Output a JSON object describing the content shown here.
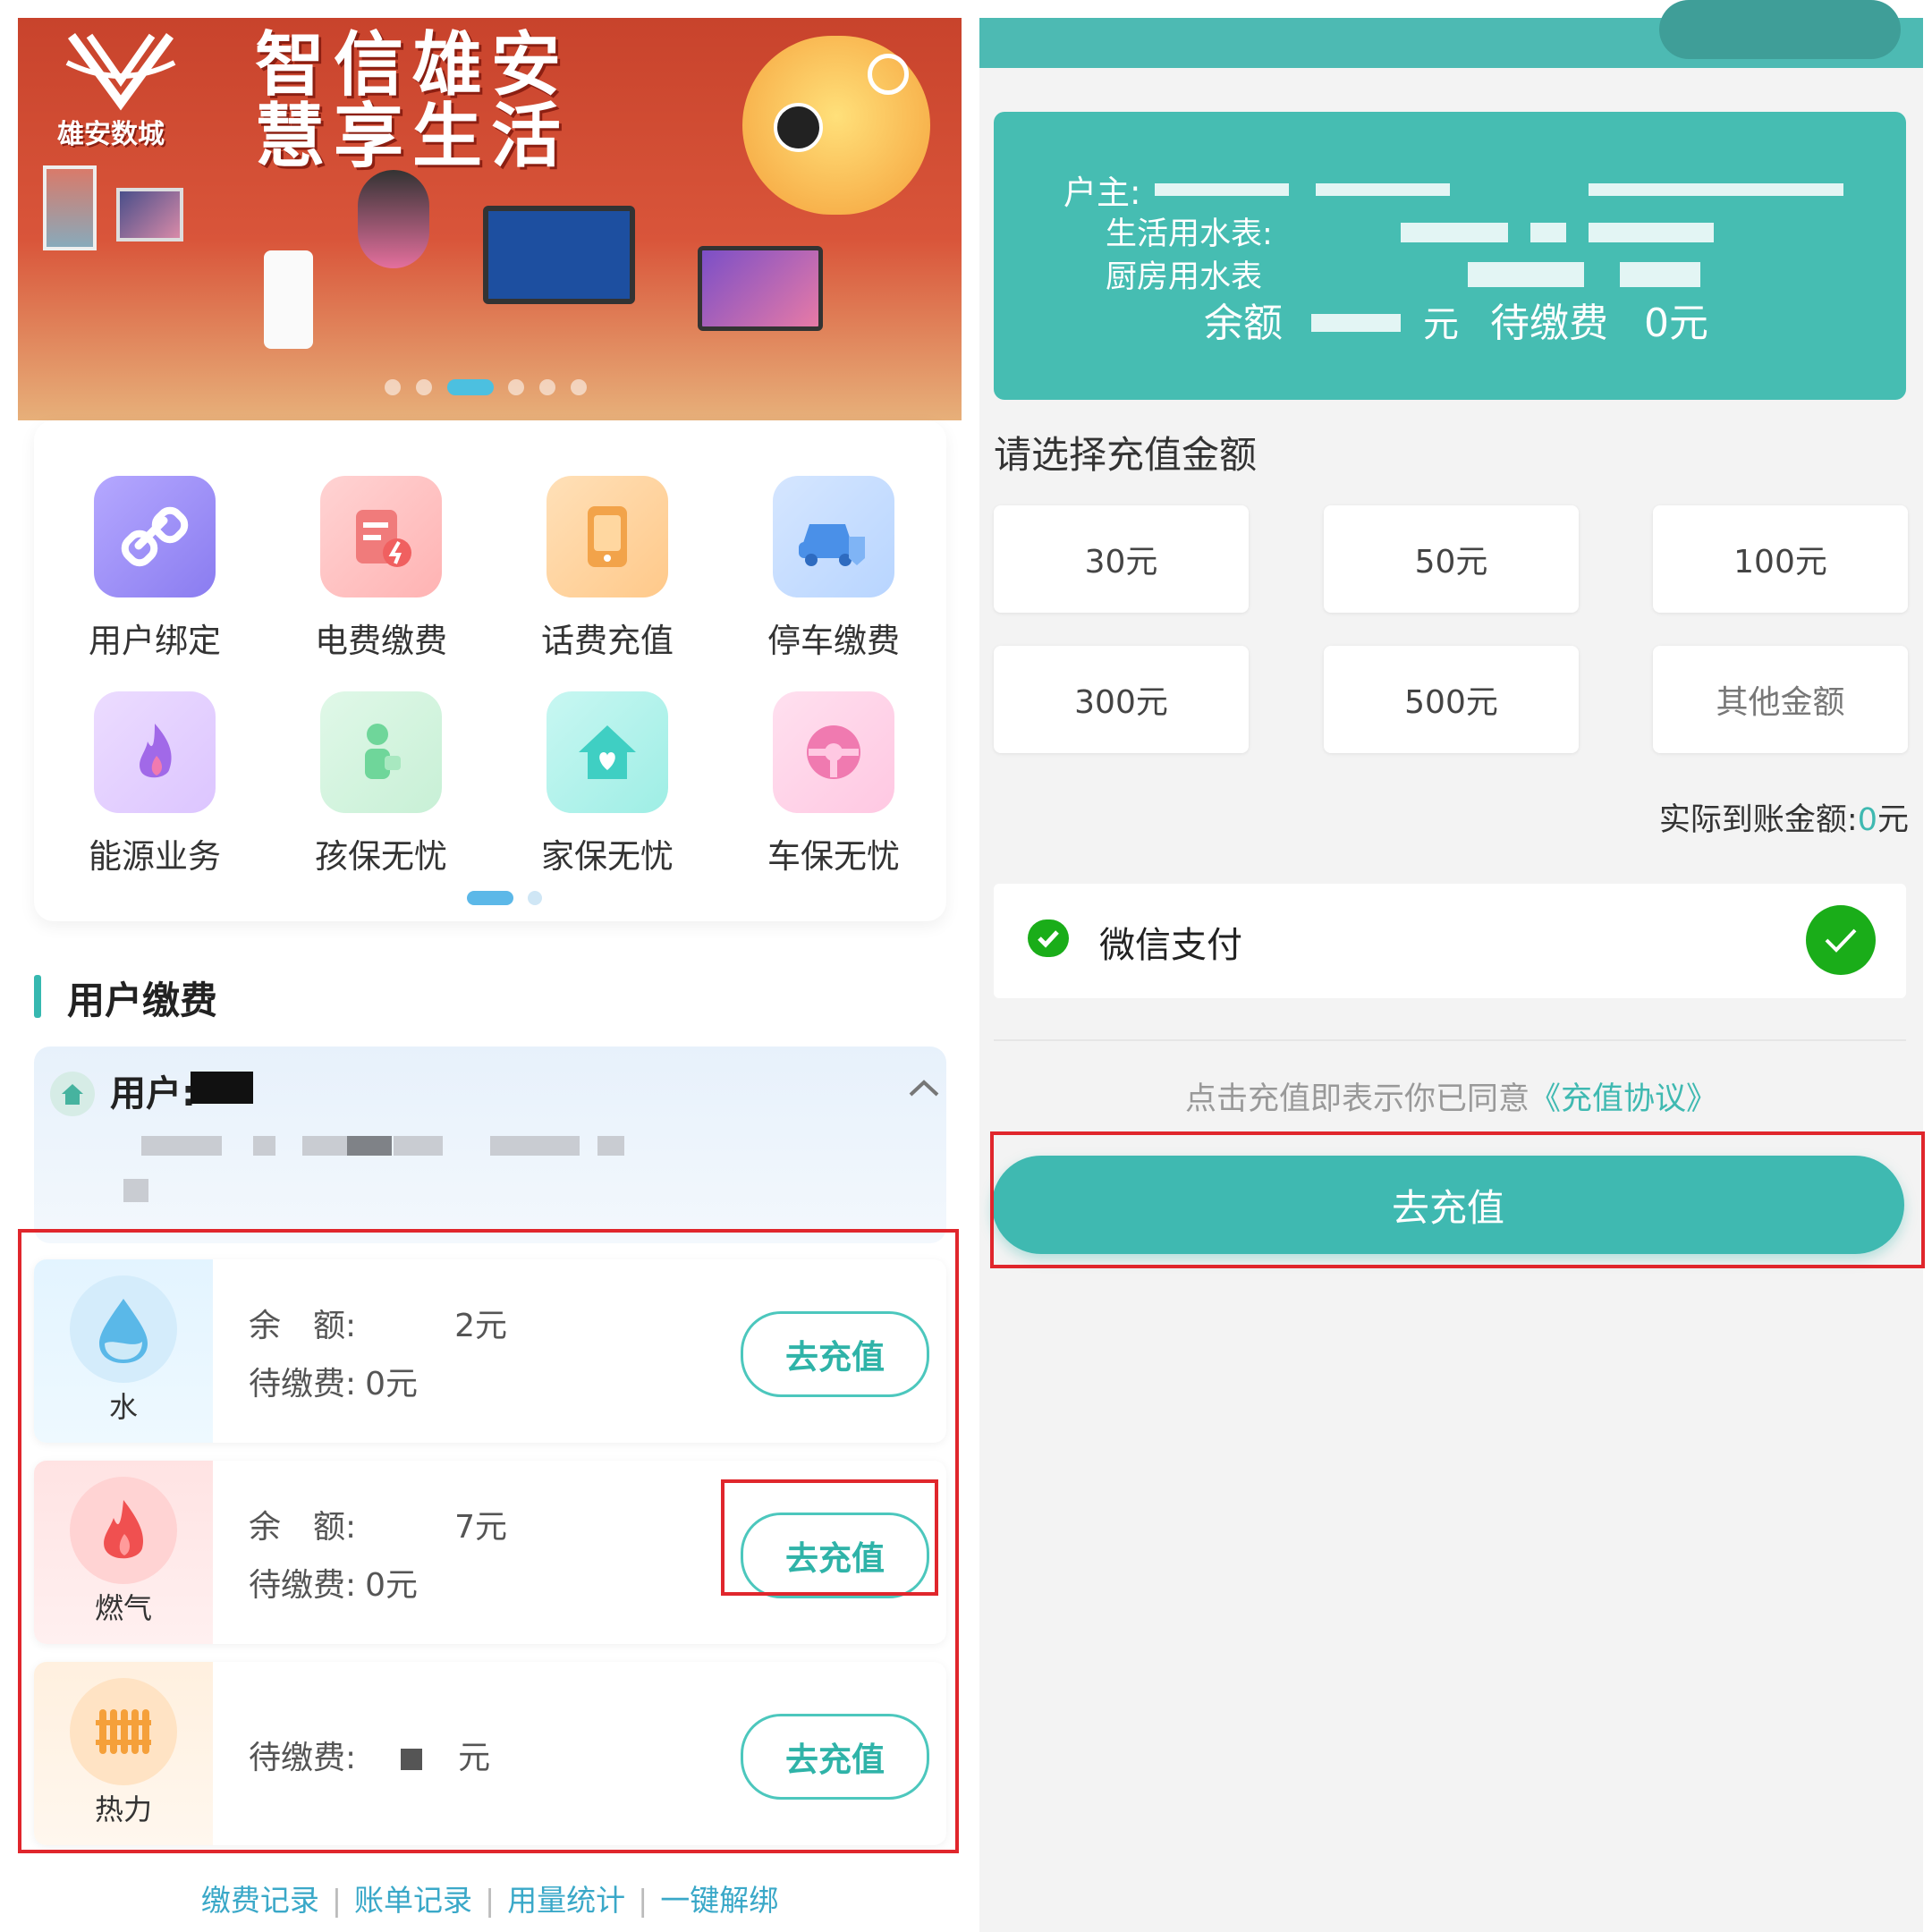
{
  "left": {
    "banner": {
      "slogan_line1": "智信雄安",
      "slogan_line2": "慧享生活",
      "brand_name": "雄安数城",
      "carousel_dots": 6,
      "carousel_active_index": 2
    },
    "services": [
      {
        "label": "用户绑定",
        "icon": "link-icon",
        "color": "#8a7cf0"
      },
      {
        "label": "电费缴费",
        "icon": "electric-bill-icon",
        "color": "#f07b7b"
      },
      {
        "label": "话费充值",
        "icon": "phone-recharge-icon",
        "color": "#f2a34a"
      },
      {
        "label": "停车缴费",
        "icon": "parking-car-icon",
        "color": "#4a90e8"
      },
      {
        "label": "能源业务",
        "icon": "flame-icon",
        "color": "#a169e8"
      },
      {
        "label": "孩保无忧",
        "icon": "child-insurance-icon",
        "color": "#6fd69a"
      },
      {
        "label": "家保无忧",
        "icon": "house-heart-icon",
        "color": "#3fcfc3"
      },
      {
        "label": "车保无忧",
        "icon": "steering-wheel-icon",
        "color": "#f07ab0"
      }
    ],
    "section_title": "用户缴费",
    "user_label": "用户:",
    "utilities": [
      {
        "name": "水",
        "icon": "water-drop-icon",
        "balance_label": "余　额:",
        "balance_value": "2元",
        "due_label": "待缴费:",
        "due_value": "0元",
        "button": "去充值"
      },
      {
        "name": "燃气",
        "icon": "gas-flame-icon",
        "balance_label": "余　额:",
        "balance_value": "7元",
        "due_label": "待缴费:",
        "due_value": "0元",
        "button": "去充值"
      },
      {
        "name": "热力",
        "icon": "radiator-icon",
        "due_label": "待缴费:",
        "due_value": "元",
        "button": "去充值"
      }
    ],
    "bottom_links": [
      "缴费记录",
      "账单记录",
      "用量统计",
      "一键解绑"
    ]
  },
  "right": {
    "info": {
      "owner_label": "户主:",
      "water_label": "生活用水表:",
      "kitchen_label": "厨房用水表",
      "balance_label": "余额",
      "balance_unit": "元",
      "due_label": "待缴费",
      "due_value": "0元"
    },
    "select_title": "请选择充值金额",
    "amounts": [
      "30元",
      "50元",
      "100元",
      "300元",
      "500元",
      "其他金额"
    ],
    "actual_label": "实际到账金额:",
    "actual_value": "0",
    "actual_unit": "元",
    "payment_method": "微信支付",
    "agreement_text": "点击充值即表示你已同意",
    "agreement_link": "《充值协议》",
    "charge_button": "去充值"
  },
  "colors": {
    "accent": "#3fb9b1",
    "highlight_box": "#e0262c",
    "wechat_green": "#1aad19"
  }
}
